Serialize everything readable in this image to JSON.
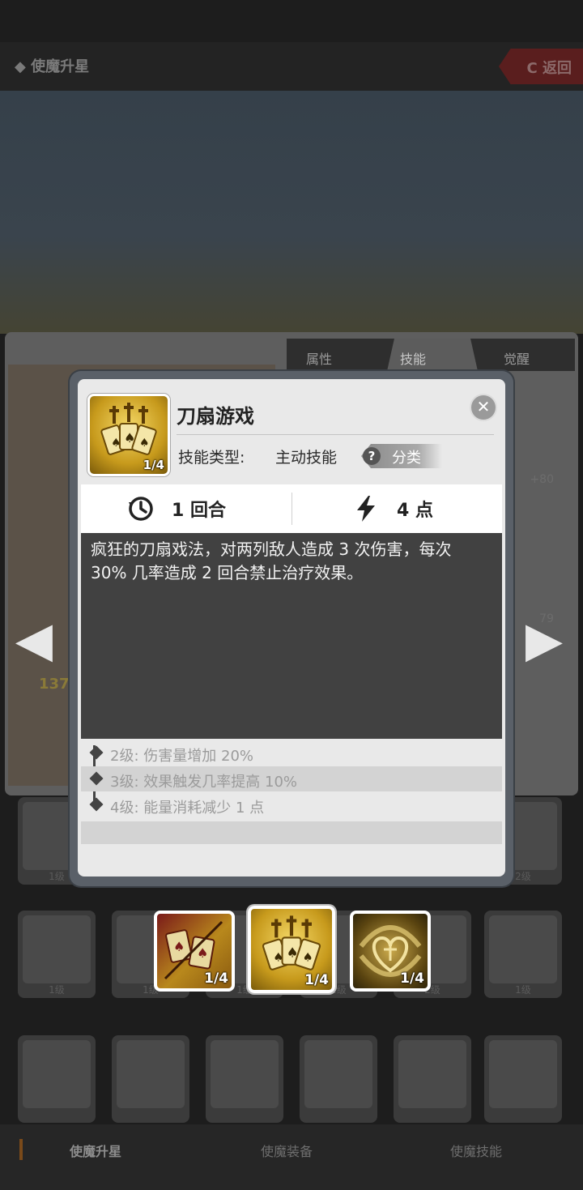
{
  "header": {
    "title": "◆ 使魔升星",
    "back_label": "C 返回"
  },
  "background": {
    "tabs": [
      "属性",
      "技能",
      "觉醒"
    ],
    "active_tab": "技能",
    "attack_value": "137",
    "side_values": [
      "+80",
      "79"
    ],
    "grid_levels": [
      "1级",
      "2级",
      "1级",
      "1级",
      "1级",
      "1级",
      "2级",
      "1级"
    ]
  },
  "bottom_nav": {
    "tabs": [
      "使魔升星",
      "使魔装备",
      "使魔技能"
    ],
    "active_tab": "使魔升星"
  },
  "skill_popup": {
    "name": "刀扇游戏",
    "icon_badge": "1/4",
    "type_label": "技能类型:",
    "type_value": "主动技能",
    "category_label": "分类",
    "cooldown_value": "1 回合",
    "energy_value": "4 点",
    "description": "疯狂的刀扇戏法，对两列敌人造成 3 次伤害，每次 30% 几率造成 2 回合禁止治疗效果。",
    "levels": [
      {
        "level": "2级:",
        "text": "伤害量增加 20%"
      },
      {
        "level": "3级:",
        "text": "效果触发几率提高 10%"
      },
      {
        "level": "4级:",
        "text": "能量消耗减少 1 点"
      }
    ]
  },
  "skill_selector": [
    {
      "badge": "1/4",
      "icon": "cards-swords-icon",
      "selected": false
    },
    {
      "badge": "1/4",
      "icon": "blade-fan-cards-icon",
      "selected": true
    },
    {
      "badge": "1/4",
      "icon": "heart-swirl-icon",
      "selected": false
    }
  ],
  "colors": {
    "modal_bg": "#e9e9e9",
    "description_bg": "#414141",
    "icon_gold": "#c79a1c",
    "level_text": "#9b9b9b"
  }
}
